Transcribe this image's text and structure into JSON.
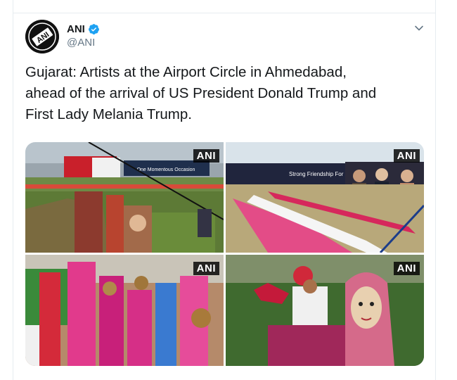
{
  "tweet": {
    "display_name": "ANI",
    "handle": "@ANI",
    "avatar_logo_text": "ANI",
    "text": "Gujarat: Artists at the Airport Circle in Ahmedabad,\nahead of the arrival of US President Donald Trump and\nFirst Lady Melania Trump.",
    "verified": true
  },
  "media": {
    "photo_count": 4,
    "watermarks": [
      "ANI",
      "ANI",
      "ANI",
      "ANI"
    ],
    "banner_texts": {
      "photo_1": "One Momentous Occasion",
      "photo_2": "Strong Friendship For a Brighter Future"
    }
  },
  "colors": {
    "text": "#14171a",
    "secondary": "#657786",
    "verified_blue": "#1da1f2",
    "border": "#e6ecf0"
  }
}
